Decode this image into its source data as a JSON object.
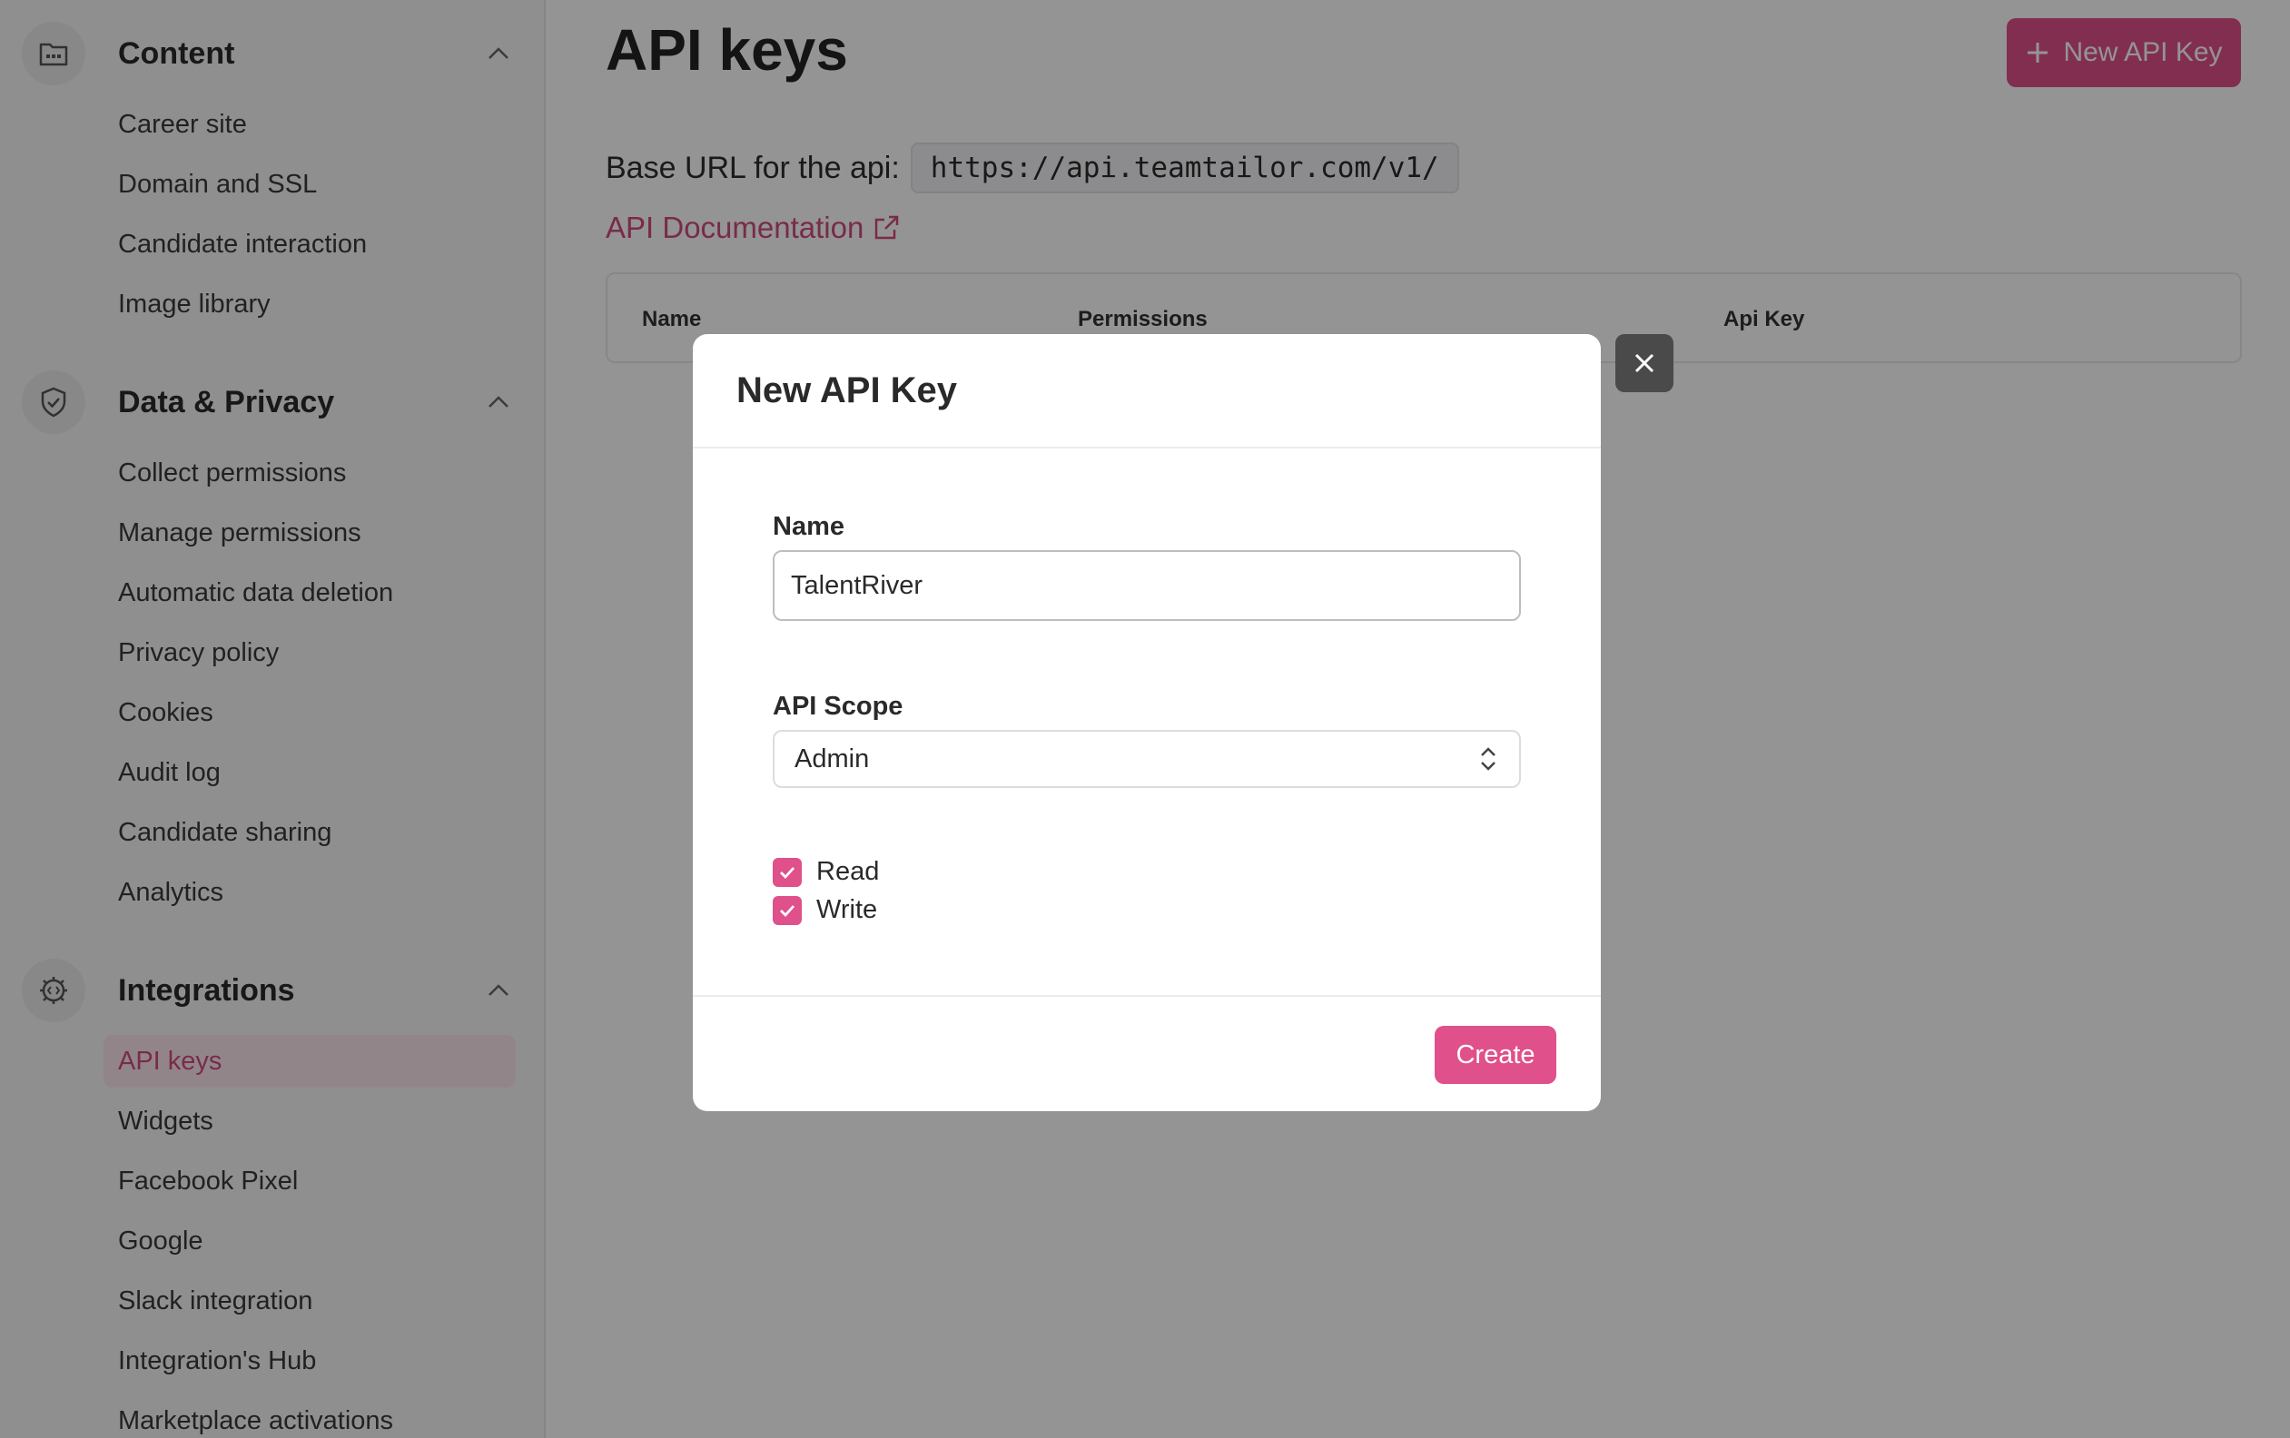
{
  "sidebar": {
    "sections": [
      {
        "title": "Content",
        "icon": "folder-icon",
        "items": [
          "Career site",
          "Domain and SSL",
          "Candidate interaction",
          "Image library"
        ]
      },
      {
        "title": "Data & Privacy",
        "icon": "shield-check-icon",
        "items": [
          "Collect permissions",
          "Manage permissions",
          "Automatic data deletion",
          "Privacy policy",
          "Cookies",
          "Audit log",
          "Candidate sharing",
          "Analytics"
        ]
      },
      {
        "title": "Integrations",
        "icon": "gear-code-icon",
        "items": [
          "API keys",
          "Widgets",
          "Facebook Pixel",
          "Google",
          "Slack integration",
          "Integration's Hub",
          "Marketplace activations"
        ],
        "active": "API keys"
      }
    ]
  },
  "main": {
    "title": "API keys",
    "new_button": "New API Key",
    "base_url_label": "Base URL for the api:",
    "base_url": "https://api.teamtailor.com/v1/",
    "doc_link": "API Documentation",
    "table_headers": [
      "Name",
      "Permissions",
      "Api Key"
    ]
  },
  "modal": {
    "title": "New API Key",
    "name_label": "Name",
    "name_value": "TalentRiver",
    "scope_label": "API Scope",
    "scope_value": "Admin",
    "checkboxes": [
      {
        "label": "Read",
        "checked": true
      },
      {
        "label": "Write",
        "checked": true
      }
    ],
    "create_button": "Create"
  },
  "colors": {
    "accent": "#e0508a",
    "accent_text": "#d14a7e"
  }
}
